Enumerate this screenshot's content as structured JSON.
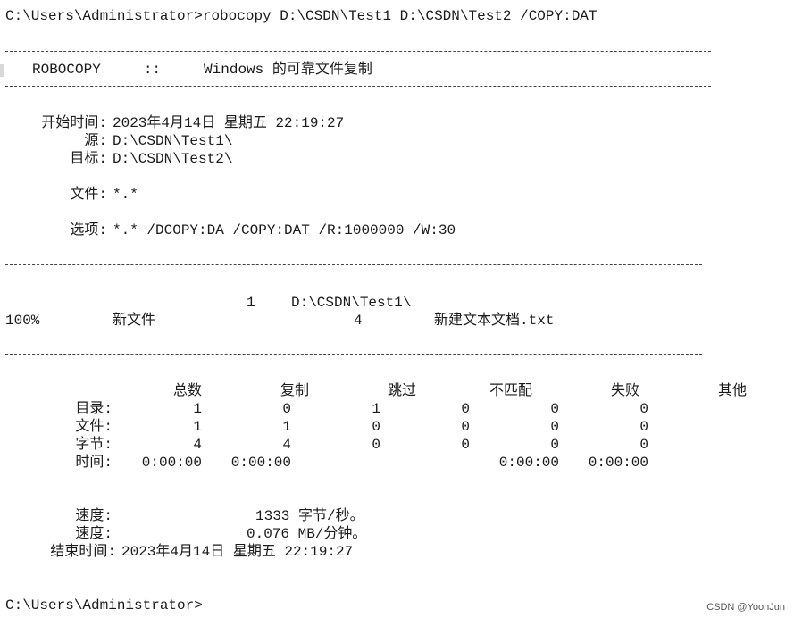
{
  "console": {
    "command_line": "C:\\Users\\Administrator>robocopy D:\\CSDN\\Test1 D:\\CSDN\\Test2 /COPY:DAT",
    "banner": "ROBOCOPY     ::     Windows 的可靠文件复制",
    "header": {
      "start_label": "开始时间:",
      "start_value": "2023年4月14日 星期五 22:19:27",
      "source_label": "源:",
      "source_value": "D:\\CSDN\\Test1\\",
      "dest_label": "目标:",
      "dest_value": "D:\\CSDN\\Test2\\",
      "files_label": "文件:",
      "files_value": "*.*",
      "options_label": "选项:",
      "options_value": "*.* /DCOPY:DA /COPY:DAT /R:1000000 /W:30"
    },
    "dir_line": {
      "count": "1",
      "path": "D:\\CSDN\\Test1\\"
    },
    "file_line": {
      "percent": "100%",
      "status": "新文件",
      "size": "4",
      "name": "新建文本文档.txt"
    },
    "summary": {
      "columns": [
        "总数",
        "复制",
        "跳过",
        "不匹配",
        "失败",
        "其他"
      ],
      "rows": [
        {
          "label": "目录:",
          "values": [
            "1",
            "0",
            "1",
            "0",
            "0",
            "0"
          ]
        },
        {
          "label": "文件:",
          "values": [
            "1",
            "1",
            "0",
            "0",
            "0",
            "0"
          ]
        },
        {
          "label": "字节:",
          "values": [
            "4",
            "4",
            "0",
            "0",
            "0",
            "0"
          ]
        },
        {
          "label": "时间:",
          "values": [
            "0:00:00",
            "0:00:00",
            "",
            "",
            "0:00:00",
            "0:00:00"
          ]
        }
      ]
    },
    "speed": {
      "label1": "速度:",
      "value1": "1333 字节/秒。",
      "label2": "速度:",
      "value2": "0.076 MB/分钟。"
    },
    "end": {
      "label": "结束时间:",
      "value": "2023年4月14日 星期五 22:19:27"
    },
    "prompt": "C:\\Users\\Administrator>"
  },
  "watermark": "CSDN @YoonJun"
}
